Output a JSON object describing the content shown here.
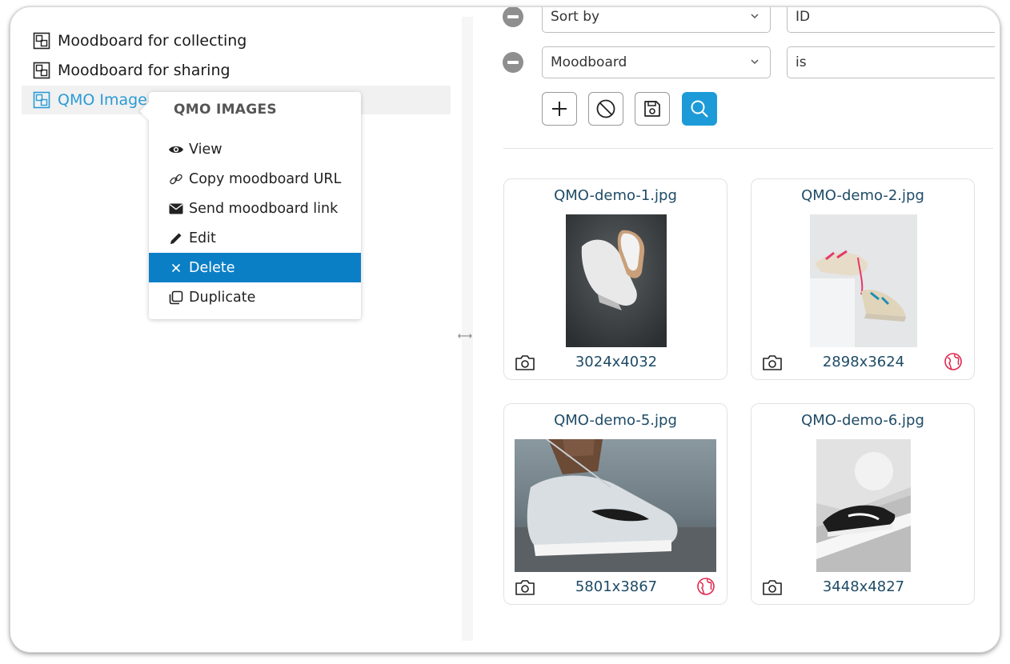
{
  "tree": {
    "items": [
      {
        "label": "Moodboard for collecting",
        "active": false
      },
      {
        "label": "Moodboard for sharing",
        "active": false
      },
      {
        "label": "QMO Image",
        "active": true
      }
    ]
  },
  "context_menu": {
    "title": "QMO IMAGES",
    "items": [
      {
        "label": "View",
        "icon": "eye-icon"
      },
      {
        "label": "Copy moodboard URL",
        "icon": "link-icon"
      },
      {
        "label": "Send moodboard link",
        "icon": "envelope-icon"
      },
      {
        "label": "Edit",
        "icon": "pencil-icon"
      },
      {
        "label": "Delete",
        "icon": "close-icon",
        "highlighted": true
      },
      {
        "label": "Duplicate",
        "icon": "duplicate-icon"
      }
    ]
  },
  "filters": {
    "rows": [
      {
        "field": "Sort by",
        "value": "ID"
      },
      {
        "field": "Moodboard",
        "value": "is"
      }
    ]
  },
  "toolbar": {
    "buttons": [
      "add-button",
      "clear-button",
      "save-button",
      "search-button"
    ]
  },
  "images": [
    {
      "name": "QMO-demo-1.jpg",
      "dims": "3024x4032",
      "public": false
    },
    {
      "name": "QMO-demo-2.jpg",
      "dims": "2898x3624",
      "public": true
    },
    {
      "name": "QMO-demo-5.jpg",
      "dims": "5801x3867",
      "public": true
    },
    {
      "name": "QMO-demo-6.jpg",
      "dims": "3448x4827",
      "public": false
    }
  ],
  "colors": {
    "accent": "#2a9bd6",
    "primary_button": "#1c9bd8",
    "menu_highlight": "#0b7fc6",
    "globe_icon": "#e0264e",
    "card_text": "#1e4b66"
  }
}
